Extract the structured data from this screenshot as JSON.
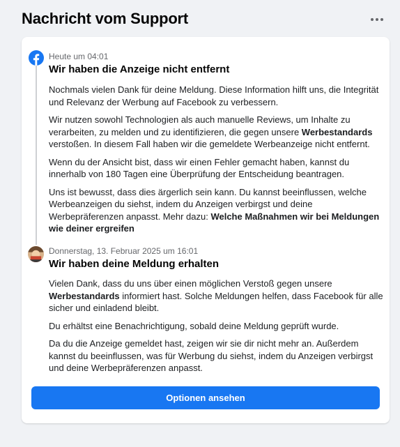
{
  "header": {
    "title": "Nachricht vom Support"
  },
  "messages": [
    {
      "timestamp": "Heute um 04:01",
      "title": "Wir haben die Anzeige nicht entfernt",
      "p1": "Nochmals vielen Dank für deine Meldung. Diese Information hilft uns, die Integrität und Relevanz der Werbung auf Facebook zu verbessern.",
      "p2_a": "Wir nutzen sowohl Technologien als auch manuelle Reviews, um Inhalte zu verarbeiten, zu melden und zu identifizieren, die gegen unsere ",
      "p2_bold": "Werbestandards",
      "p2_b": " verstoßen. In diesem Fall haben wir die gemeldete Werbeanzeige nicht entfernt.",
      "p3": "Wenn du der Ansicht bist, dass wir einen Fehler gemacht haben, kannst du innerhalb von 180 Tagen eine Überprüfung der Entscheidung beantragen.",
      "p4_a": "Uns ist bewusst, dass dies ärgerlich sein kann. Du kannst beeinflussen, welche Werbeanzeigen du siehst, indem du Anzeigen verbirgst und deine Werbepräferenzen anpasst. Mehr dazu: ",
      "p4_bold": "Welche Maßnahmen wir bei Meldungen wie deiner ergreifen"
    },
    {
      "timestamp": "Donnerstag, 13. Februar 2025 um 16:01",
      "title": "Wir haben deine Meldung erhalten",
      "p1_a": "Vielen Dank, dass du uns über einen möglichen Verstoß gegen unsere ",
      "p1_bold": "Werbestandards",
      "p1_b": " informiert hast. Solche Meldungen helfen, dass Facebook für alle sicher und einladend bleibt.",
      "p2": "Du erhältst eine Benachrichtigung, sobald deine Meldung geprüft wurde.",
      "p3": "Da du die Anzeige gemeldet hast, zeigen wir sie dir nicht mehr an. Außerdem kannst du beeinflussen, was für Werbung du siehst, indem du Anzeigen verbirgst und deine Werbepräferenzen anpasst."
    }
  ],
  "actions": {
    "options_label": "Optionen ansehen"
  },
  "icons": {
    "more": "more-horizontal-icon",
    "sender1": "facebook-logo-icon",
    "sender2": "user-avatar"
  },
  "colors": {
    "accent": "#1877f2",
    "background": "#f0f2f5",
    "card": "#ffffff"
  }
}
